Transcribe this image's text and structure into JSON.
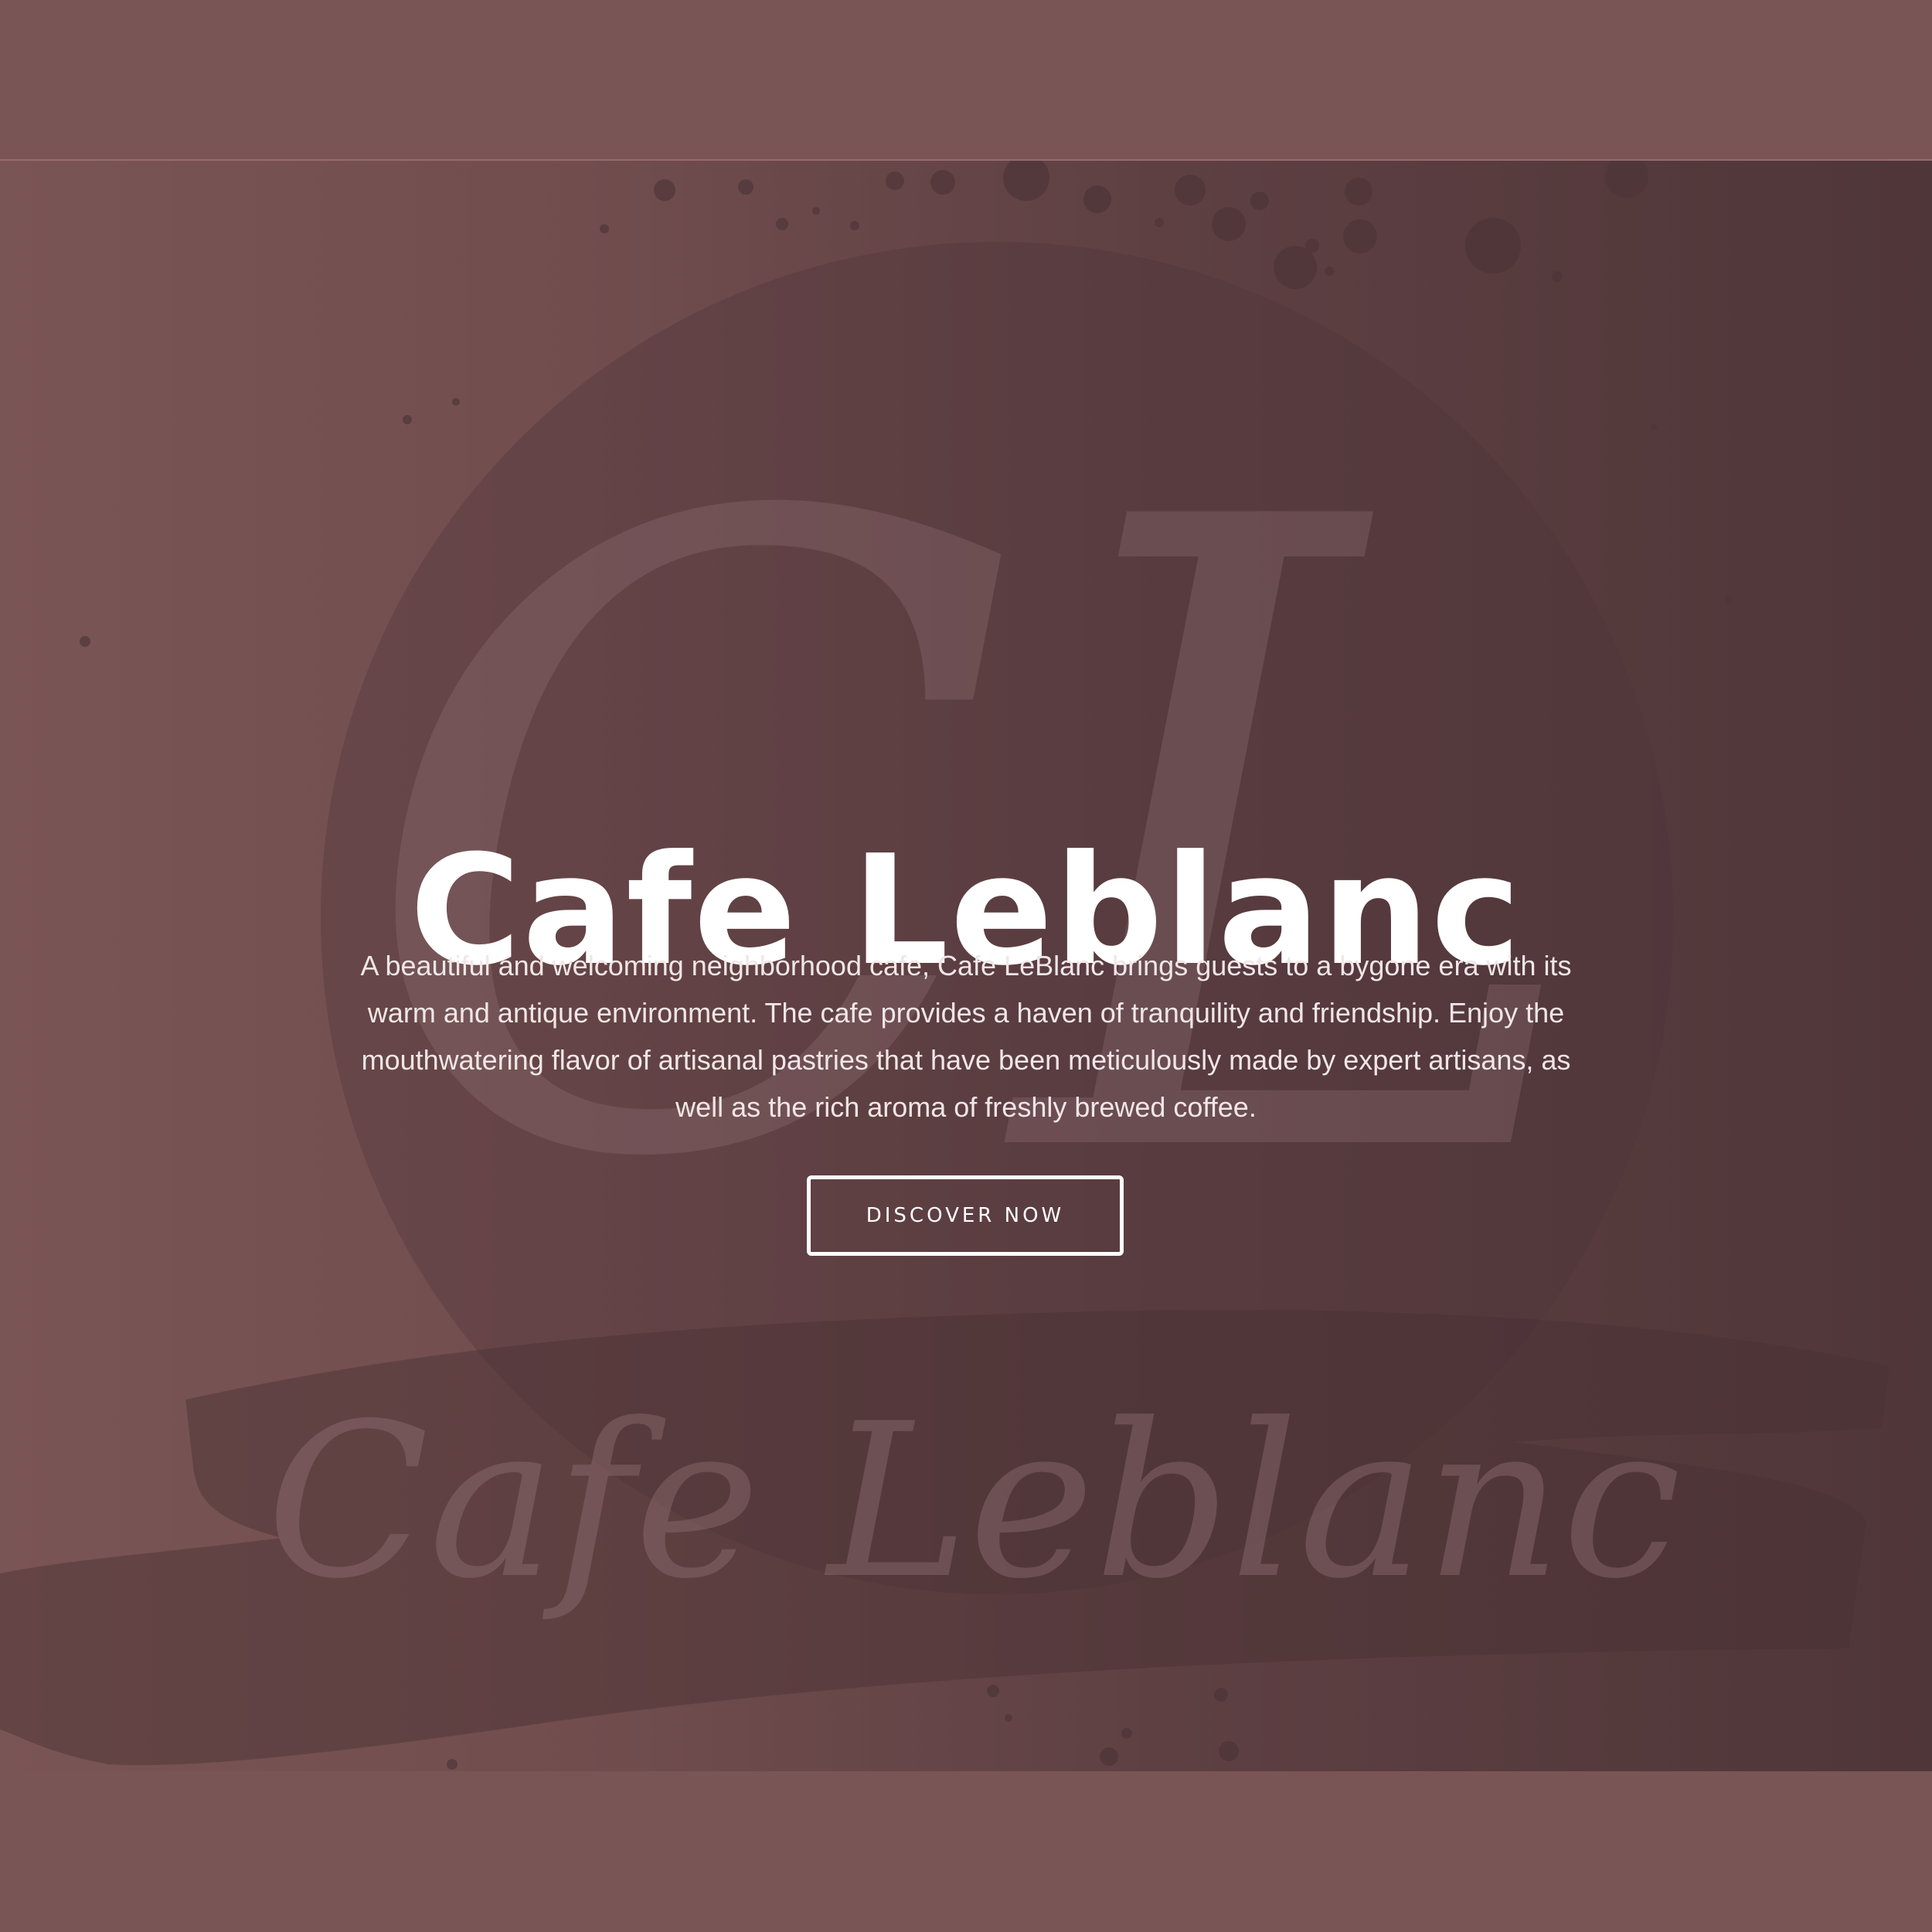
{
  "hero": {
    "title": "Cafe Leblanc",
    "description": "A beautiful and welcoming neighborhood cafe, Cafe LeBlanc brings guests to a bygone era with its warm and antique environment. The cafe provides a haven of tranquility and friendship. Enjoy the mouthwatering flavor of artisanal pastries that have been meticulously made by expert artisans, as well as the rich aroma of freshly brewed coffee.",
    "button_label": "DISCOVER NOW"
  },
  "background_logo": {
    "monogram": "CL",
    "wordmark": "Cafe Leblanc"
  },
  "colors": {
    "background": "#7a5555",
    "hero_dark": "#4f3638",
    "text": "#ffffff",
    "button_border": "#ffffff"
  }
}
